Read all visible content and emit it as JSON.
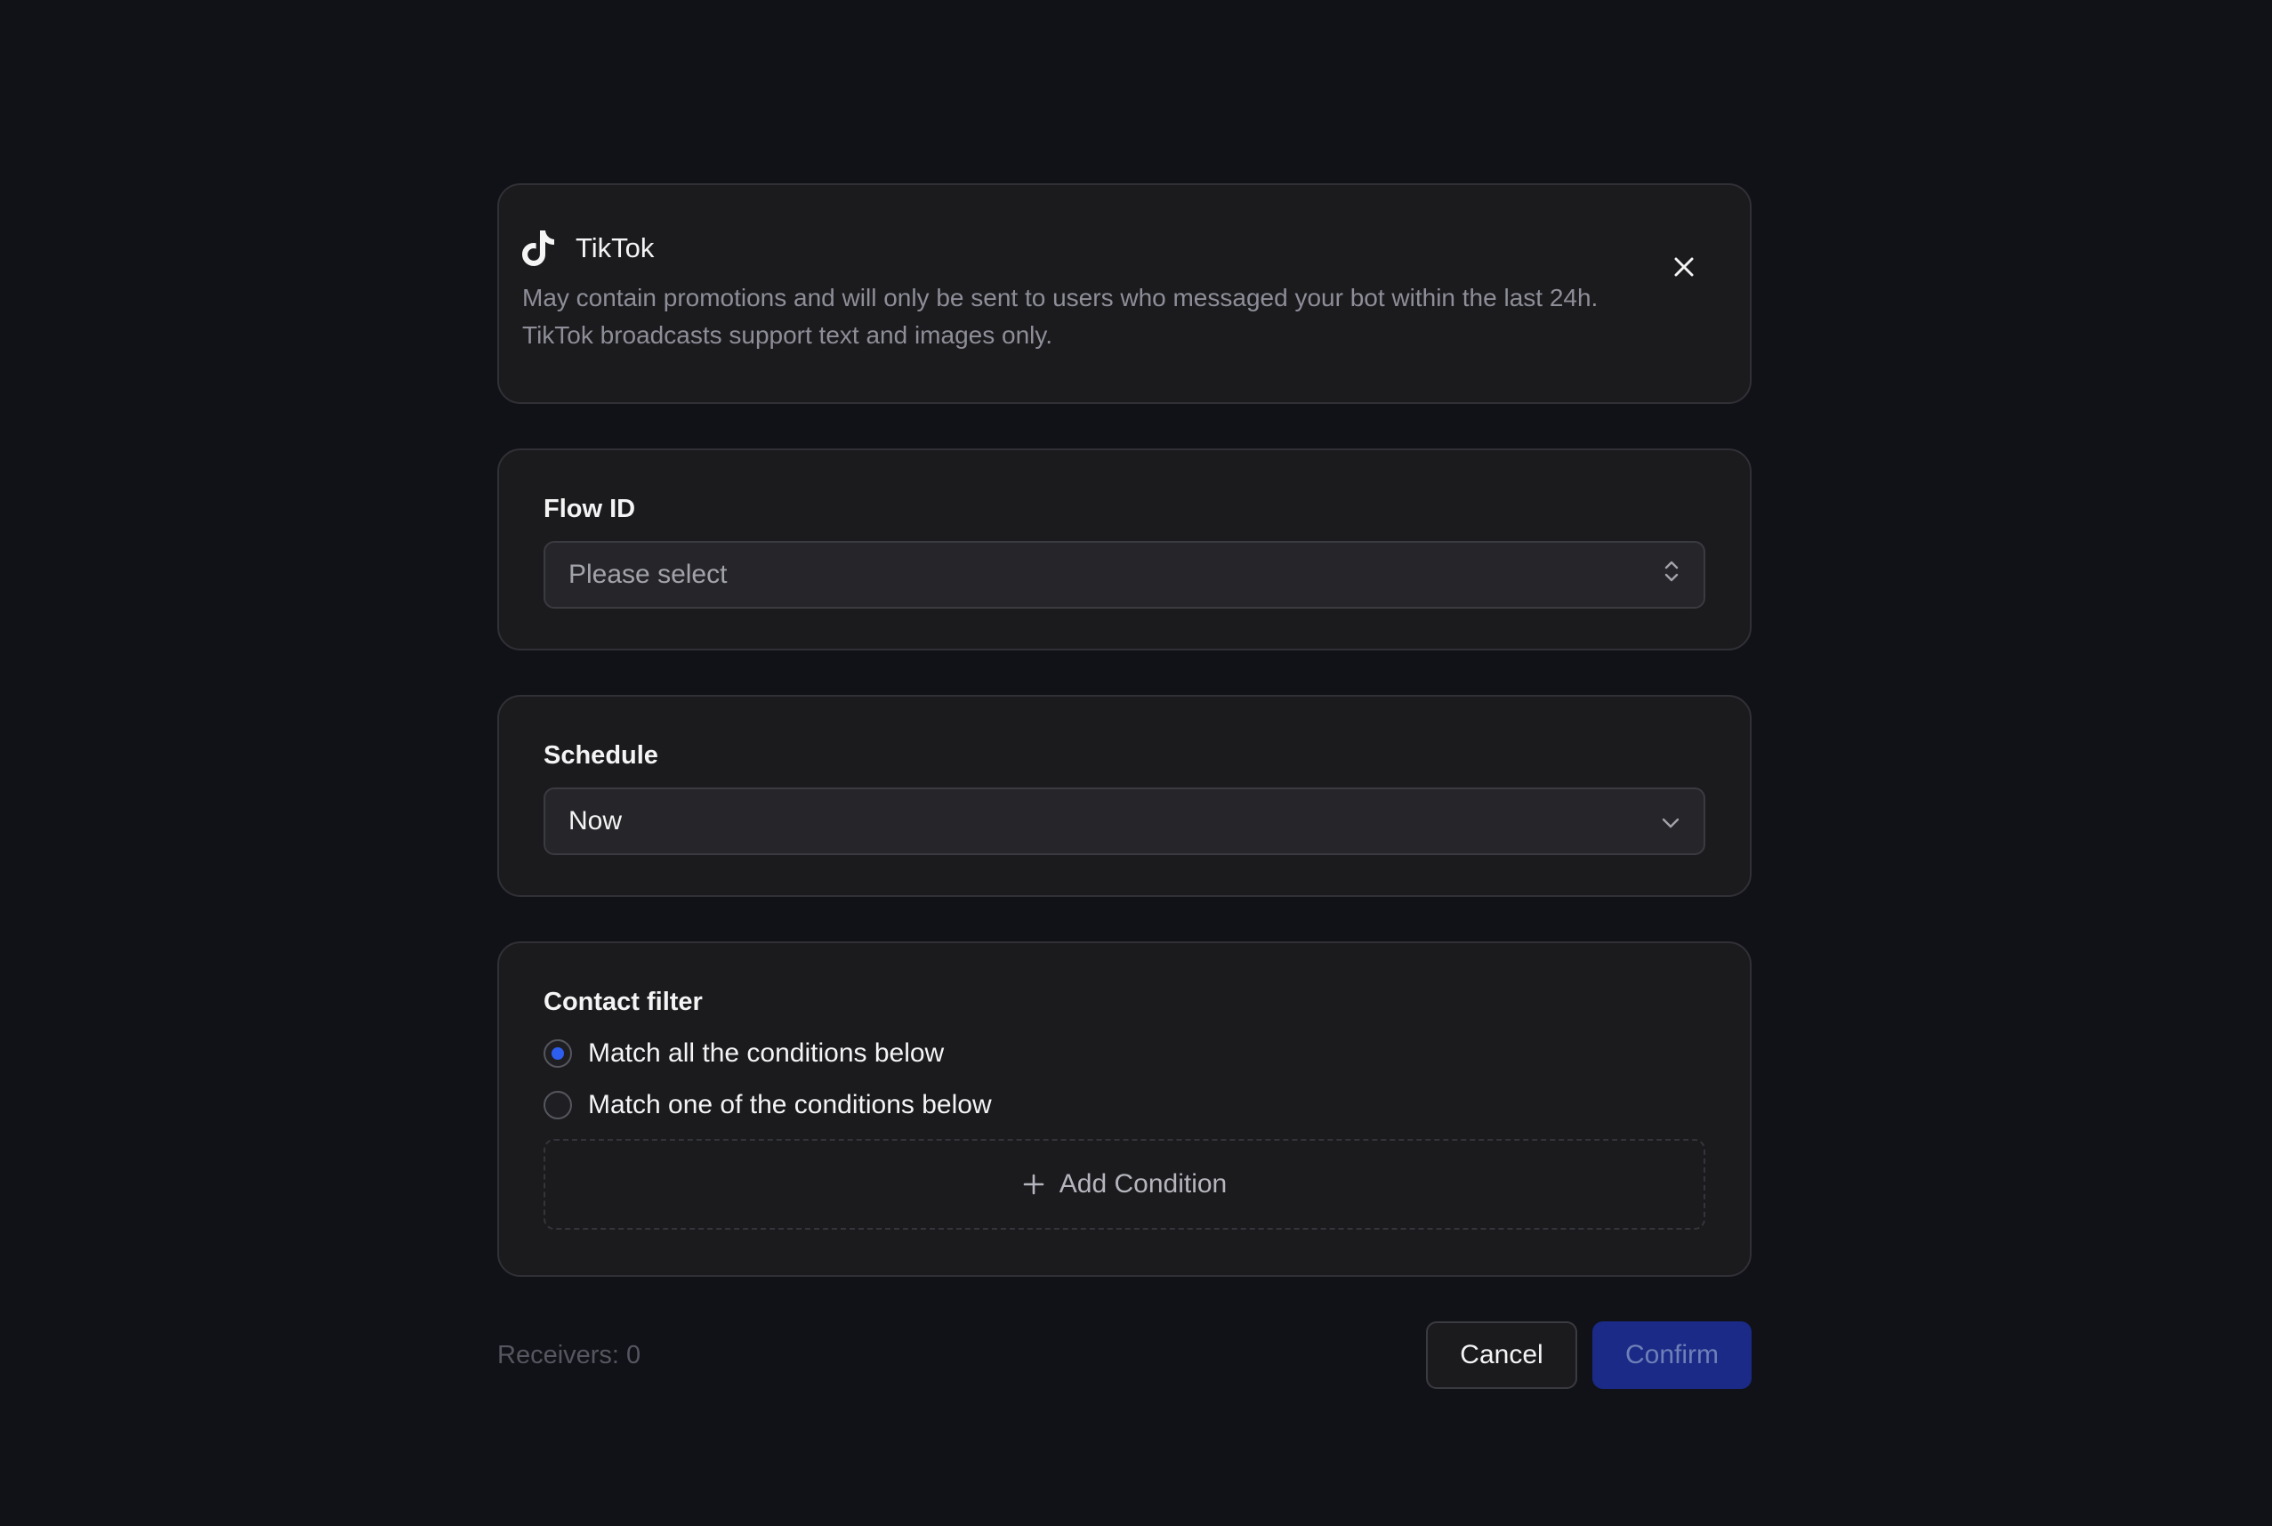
{
  "channel": {
    "name": "TikTok",
    "icon": "tiktok-icon",
    "description": "May contain promotions and will only be sent to users who messaged your bot within the last 24h. TikTok broadcasts support text and images only.",
    "close_icon": "close-icon"
  },
  "flow": {
    "label": "Flow ID",
    "placeholder": "Please select",
    "icon": "chevron-up-down-icon"
  },
  "schedule": {
    "label": "Schedule",
    "value": "Now",
    "icon": "chevron-down-icon"
  },
  "contact_filter": {
    "label": "Contact filter",
    "options": [
      {
        "label": "Match all the conditions below",
        "selected": true
      },
      {
        "label": "Match one of the conditions below",
        "selected": false
      }
    ],
    "add_condition_label": "Add Condition",
    "add_icon": "plus-icon"
  },
  "footer": {
    "receivers": "Receivers: 0",
    "cancel_label": "Cancel",
    "confirm_label": "Confirm"
  },
  "colors": {
    "background": "#111217",
    "card": "#1b1b1e",
    "accent": "#2d5ef0",
    "confirm_bg": "#1a2a86"
  }
}
